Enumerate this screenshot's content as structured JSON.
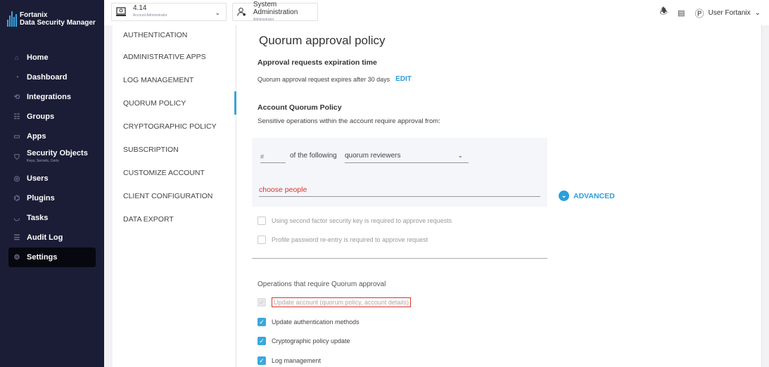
{
  "brand": {
    "name": "Fortanix",
    "product": "Data Security Manager"
  },
  "sidebar": {
    "items": [
      {
        "label": "Home",
        "icon": "home-icon",
        "glyph": "⌂"
      },
      {
        "label": "Dashboard",
        "icon": "dashboard-icon",
        "glyph": "◔"
      },
      {
        "label": "Integrations",
        "icon": "integrations-icon",
        "glyph": "⟲"
      },
      {
        "label": "Groups",
        "icon": "groups-icon",
        "glyph": "☷"
      },
      {
        "label": "Apps",
        "icon": "apps-icon",
        "glyph": "▭"
      },
      {
        "label": "Security Objects",
        "sublabel": "Keys, Secrets, Certs",
        "icon": "security-objects-icon",
        "glyph": "⛉"
      },
      {
        "label": "Users",
        "icon": "users-icon",
        "glyph": "◎"
      },
      {
        "label": "Plugins",
        "icon": "plugins-icon",
        "glyph": "⌬"
      },
      {
        "label": "Tasks",
        "icon": "tasks-icon",
        "glyph": "◡"
      },
      {
        "label": "Audit Log",
        "icon": "audit-log-icon",
        "glyph": "☰"
      },
      {
        "label": "Settings",
        "icon": "settings-icon",
        "glyph": "⚙"
      }
    ]
  },
  "topbar": {
    "account_name": "4.14",
    "account_role": "Account Administrator",
    "system_name": "System Administration",
    "system_role": "Administrator",
    "user_name": "User Fortanix"
  },
  "submenu": {
    "items": [
      "AUTHENTICATION",
      "ADMINISTRATIVE APPS",
      "LOG MANAGEMENT",
      "QUORUM POLICY",
      "CRYPTOGRAPHIC POLICY",
      "SUBSCRIPTION",
      "CUSTOMIZE ACCOUNT",
      "CLIENT CONFIGURATION",
      "DATA EXPORT"
    ],
    "active": "QUORUM POLICY"
  },
  "main": {
    "title": "Quorum approval policy",
    "expiration_heading": "Approval requests expiration time",
    "expiration_text": "Quorum approval request expires after 30 days",
    "edit_label": "EDIT",
    "account_policy_heading": "Account Quorum Policy",
    "account_policy_desc": "Sensitive operations within the account require approval from:",
    "count_placeholder": "#",
    "reviewers_label": "of the following",
    "reviewers_select": "quorum reviewers",
    "choose_people": "choose people",
    "advanced_label": "ADVANCED",
    "option_second_factor": "Using second factor security key is required to approve requests",
    "option_password": "Profile password re-entry is required to approve request",
    "ops_title": "Operations that require Quorum approval",
    "ops": [
      {
        "label": "Update account (quorum policy, account details)",
        "checked": true,
        "disabled": true
      },
      {
        "label": "Update authentication methods",
        "checked": true,
        "disabled": false
      },
      {
        "label": "Cryptographic policy update",
        "checked": true,
        "disabled": false
      },
      {
        "label": "Log management",
        "checked": true,
        "disabled": false
      }
    ]
  },
  "colors": {
    "accent": "#2c9fd9",
    "sidebar": "#1b1d36",
    "error": "#d9342b"
  }
}
